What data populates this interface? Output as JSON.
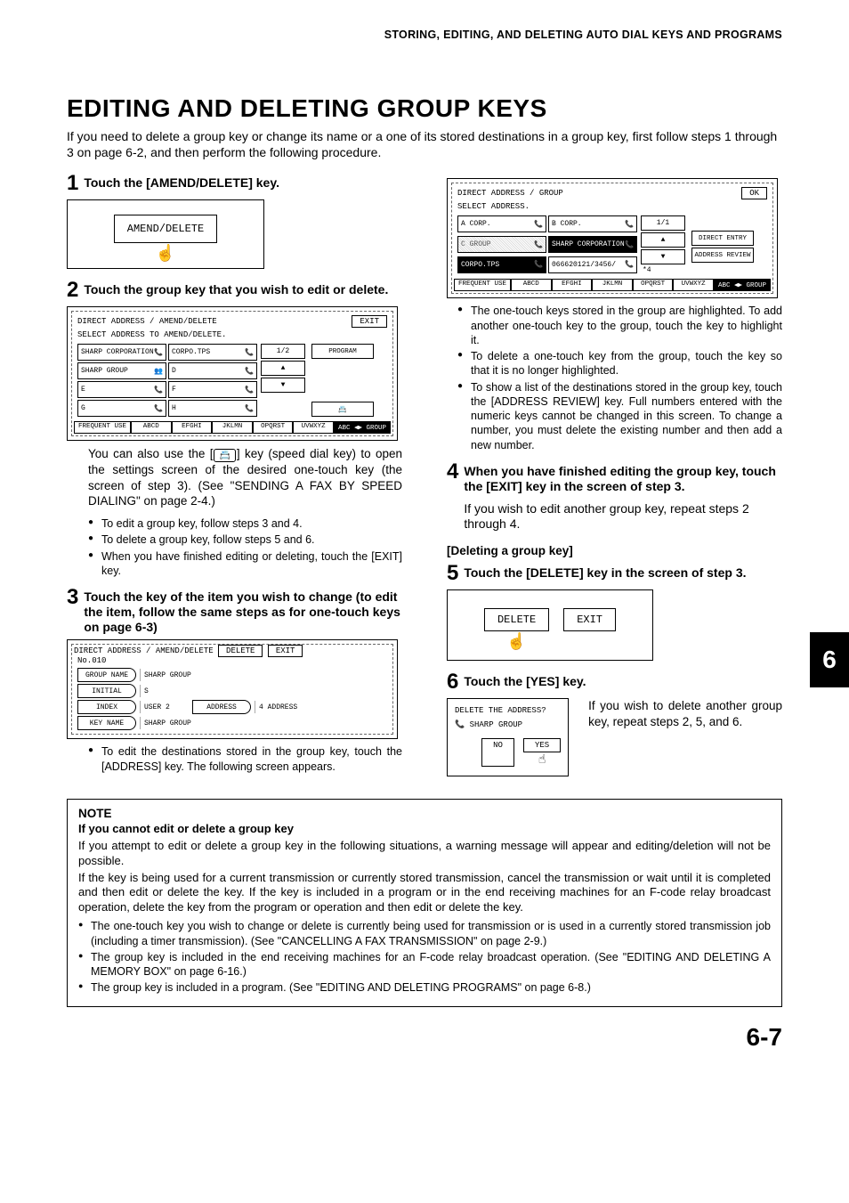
{
  "header": "STORING, EDITING, AND DELETING AUTO DIAL KEYS AND PROGRAMS",
  "title": "EDITING AND DELETING GROUP KEYS",
  "intro": "If you need to delete a group key or change its name or a one of its stored destinations in a group key, first follow steps 1 through 3 on page 6-2, and then perform the following procedure.",
  "section_right_heading": "[Deleting a group key]",
  "side_tab": "6",
  "page_number": "6-7",
  "steps": {
    "s1": {
      "num": "1",
      "title": "Touch the [AMEND/DELETE] key."
    },
    "s2": {
      "num": "2",
      "title": "Touch the group key that you wish to edit or delete."
    },
    "s3": {
      "num": "3",
      "title": "Touch the key of the item you wish to change (to edit the item, follow the same steps as for one-touch keys on page 6-3)"
    },
    "s4": {
      "num": "4",
      "title": "When you have finished editing the group key, touch the [EXIT] key in the screen of step 3.",
      "body": "If you wish to edit another group key, repeat steps 2 through 4."
    },
    "s5": {
      "num": "5",
      "title": "Touch the [DELETE] key in the screen of step 3."
    },
    "s6": {
      "num": "6",
      "title": "Touch the [YES] key.",
      "body": "If you wish to delete another group key, repeat steps 2, 5, and 6."
    }
  },
  "step2_text": {
    "para": "You can also use the [",
    "para_after": "] key (speed dial key) to open the settings screen of the desired one-touch key (the screen of step 3). (See \"SENDING A FAX BY SPEED DIALING\" on page 2-4.)",
    "bullets": [
      "To edit a group key, follow steps 3 and 4.",
      "To delete a group key, follow steps 5 and 6.",
      "When you have finished editing or deleting, touch the [EXIT] key."
    ]
  },
  "step3_text": {
    "bullets": [
      "To edit the destinations stored in the group key, touch the [ADDRESS] key. The following screen appears."
    ]
  },
  "right_top_bullets": [
    "The one-touch keys stored in the group are highlighted. To add another one-touch key to the group, touch the key to highlight it.",
    "To delete a one-touch key from the group, touch the key so that it is no longer highlighted.",
    "To show a list of the destinations stored in the group key, touch the [ADDRESS REVIEW] key. Full numbers entered with the numeric keys cannot be changed in this screen. To change a number, you must delete the existing number and then add a new number."
  ],
  "panel_amend": {
    "label": "AMEND/DELETE"
  },
  "panel_step2": {
    "path": "DIRECT ADDRESS / AMEND/DELETE",
    "exit": "EXIT",
    "subtitle": "SELECT ADDRESS TO AMEND/DELETE.",
    "cells": [
      "SHARP CORPORATION",
      "CORPO.TPS",
      "SHARP GROUP",
      "D",
      "E",
      "F",
      "G",
      "H"
    ],
    "page": "1/2",
    "program": "PROGRAM",
    "tabs": [
      "FREQUENT USE",
      "ABCD",
      "EFGHI",
      "JKLMN",
      "OPQRST",
      "UVWXYZ"
    ],
    "tab_dark": "ABC ◀▶ GROUP"
  },
  "panel_step3": {
    "path": "DIRECT ADDRESS / AMEND/DELETE",
    "delete": "DELETE",
    "exit": "EXIT",
    "no": "No.010",
    "rows": [
      {
        "label": "GROUP NAME",
        "value": "SHARP GROUP"
      },
      {
        "label": "INITIAL",
        "value": "S"
      },
      {
        "label": "INDEX",
        "value": "USER 2",
        "label2": "ADDRESS",
        "value2": "4 ADDRESS"
      },
      {
        "label": "KEY NAME",
        "value": "SHARP GROUP"
      }
    ]
  },
  "panel_right_top": {
    "path": "DIRECT ADDRESS / GROUP",
    "ok": "OK",
    "subtitle": "SELECT ADDRESS.",
    "cells": [
      "A CORP.",
      "B CORP.",
      "C GROUP",
      "SHARP CORPORATION",
      "CORPO.TPS",
      "066620121/3456/"
    ],
    "page": "1/1",
    "star": "*4",
    "btns": [
      "DIRECT ENTRY",
      "ADDRESS REVIEW"
    ],
    "tabs": [
      "FREQUENT USE",
      "ABCD",
      "EFGHI",
      "JKLMN",
      "OPQRST",
      "UVWXYZ"
    ],
    "tab_dark": "ABC ◀▶ GROUP"
  },
  "panel_delete": {
    "delete": "DELETE",
    "exit": "EXIT"
  },
  "panel_yes": {
    "q": "DELETE THE ADDRESS?",
    "group": "SHARP GROUP",
    "no": "NO",
    "yes": "YES"
  },
  "note": {
    "heading": "NOTE",
    "sub": "If you cannot edit or delete a group key",
    "p1": "If you attempt to edit or delete a group key in the following situations, a warning message will appear and editing/deletion will not be possible.",
    "p2": "If the key is being used for a current transmission or currently stored transmission, cancel the transmission or wait until it is completed and then edit or delete the key. If the key is included in a program or in the end receiving machines for an F-code relay broadcast operation, delete the key from the program or operation and then edit or delete the key.",
    "bullets": [
      "The one-touch key you wish to change or delete is currently being used for transmission or is used in a currently stored transmission job (including a timer transmission). (See \"CANCELLING A FAX TRANSMISSION\" on page 2-9.)",
      "The group key is included in the end receiving machines for an F-code relay broadcast operation. (See \"EDITING AND DELETING A MEMORY BOX\" on page 6-16.)",
      "The group key is included in a program. (See \"EDITING AND DELETING PROGRAMS\" on page 6-8.)"
    ]
  }
}
